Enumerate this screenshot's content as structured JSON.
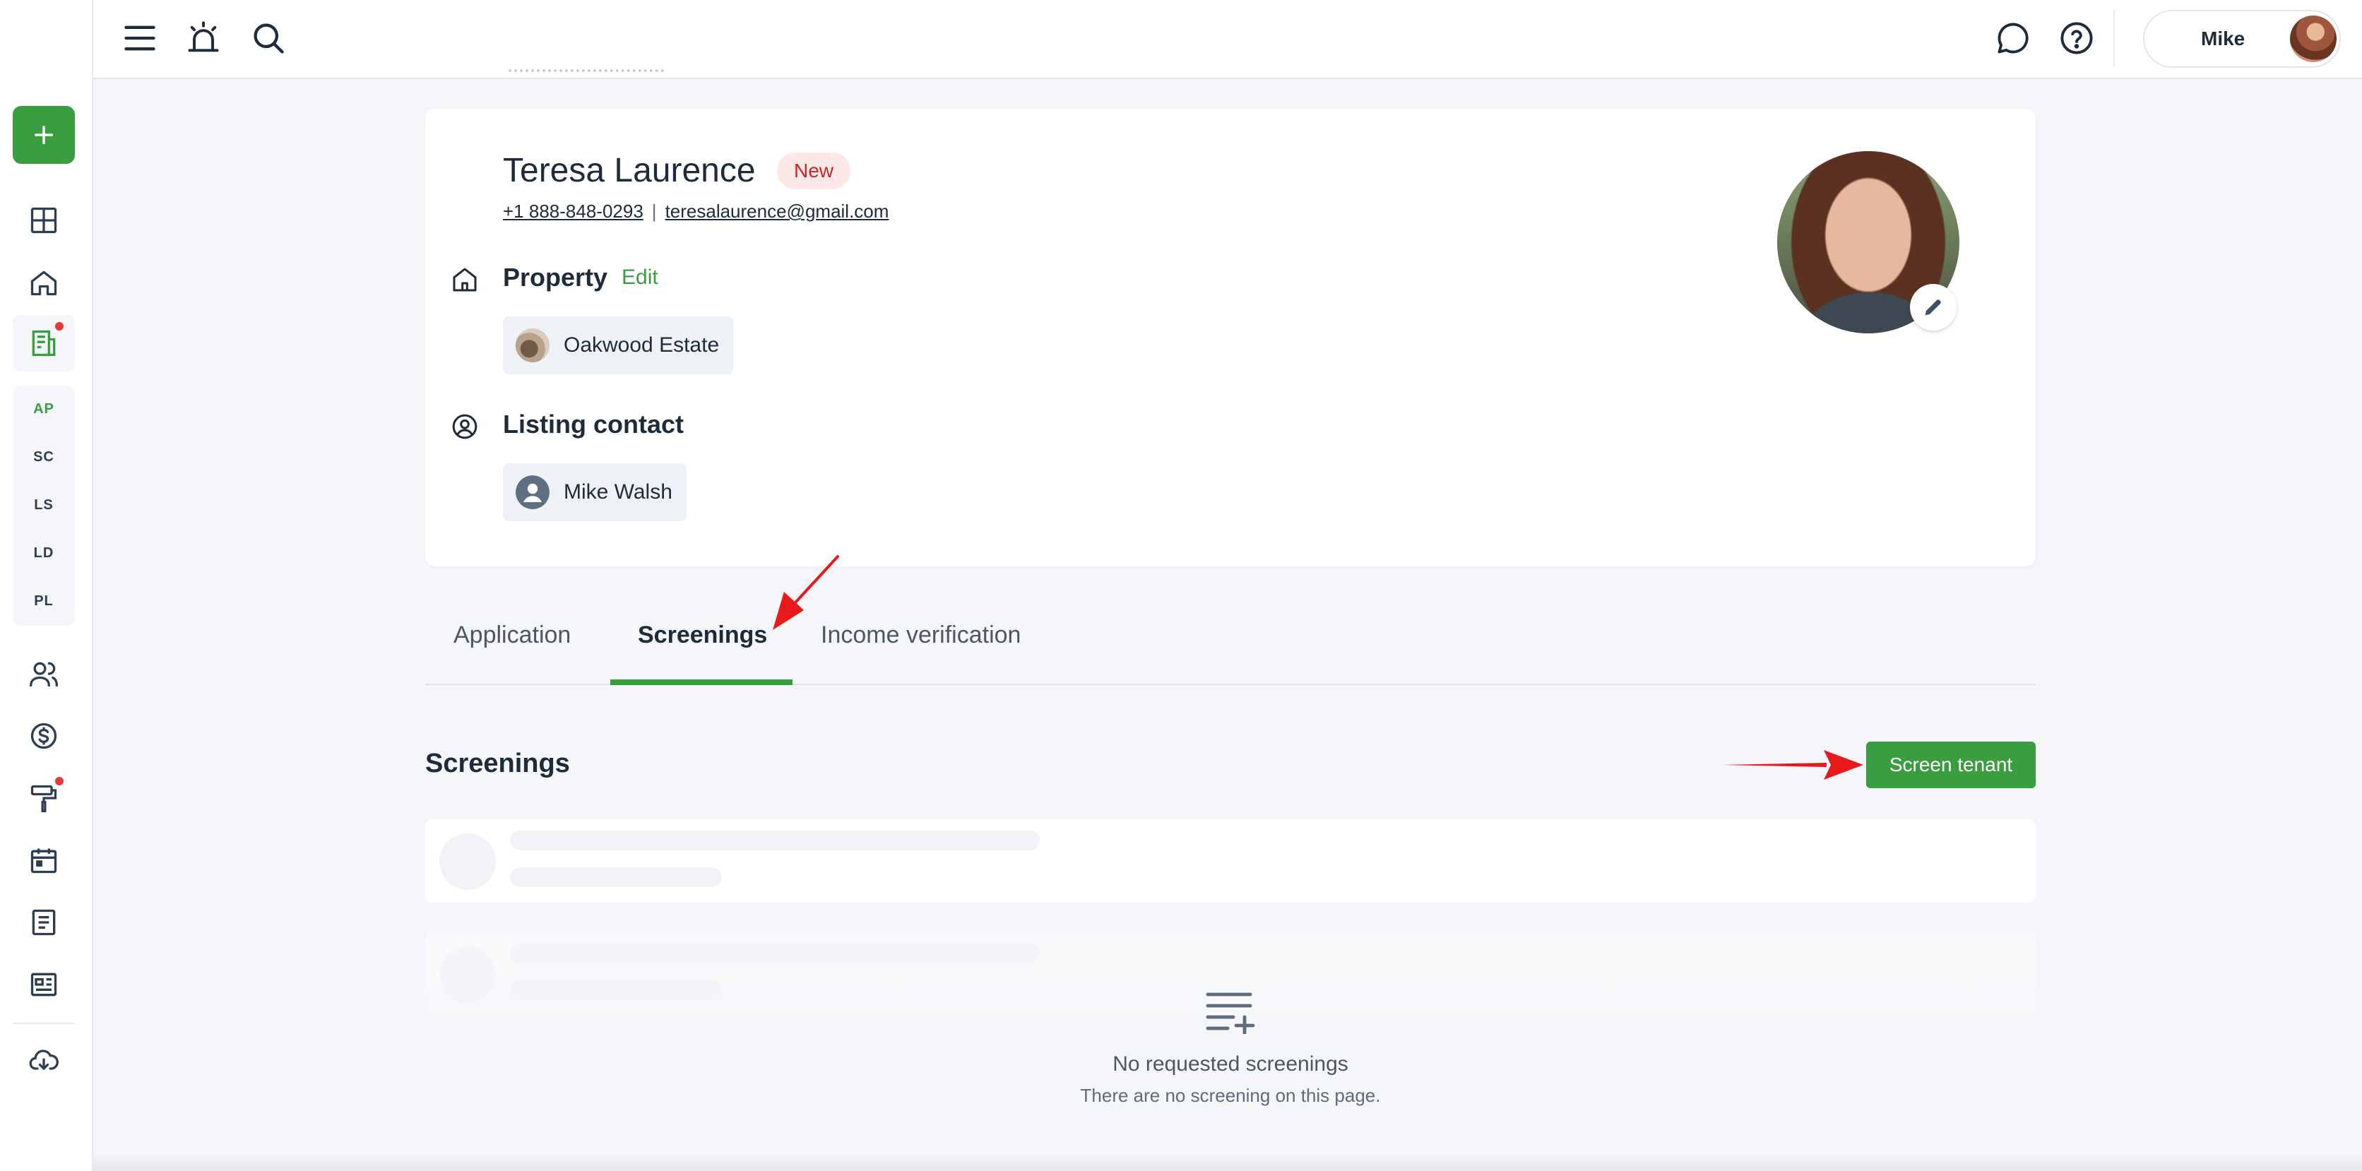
{
  "colors": {
    "accent": "#3a9d3f",
    "badge_bg": "#fde8e8",
    "badge_text": "#c62828",
    "annotation": "#e8191b"
  },
  "sidebar": {
    "add_icon": "plus-icon",
    "items": [
      {
        "icon": "dashboard-icon"
      },
      {
        "icon": "home-icon"
      },
      {
        "icon": "listings-icon",
        "notification": true
      },
      {
        "label": "AP"
      },
      {
        "label": "SC"
      },
      {
        "label": "LS"
      },
      {
        "label": "LD"
      },
      {
        "label": "PL"
      },
      {
        "icon": "users-icon"
      },
      {
        "icon": "dollar-icon"
      },
      {
        "icon": "paint-roller-icon",
        "notification": true
      },
      {
        "icon": "calendar-icon"
      },
      {
        "icon": "document-icon"
      },
      {
        "icon": "news-icon"
      },
      {
        "icon": "cloud-download-icon"
      }
    ]
  },
  "topbar": {
    "icons": [
      "menu-icon",
      "alarm-icon",
      "search-icon",
      "chat-icon",
      "help-icon"
    ],
    "user_name": "Mike"
  },
  "profile": {
    "name": "Teresa Laurence",
    "badge": "New",
    "phone": "+1 888-848-0293",
    "separator": "|",
    "email": "teresalaurence@gmail.com",
    "property": {
      "title": "Property",
      "edit_label": "Edit",
      "value": "Oakwood Estate"
    },
    "listing_contact": {
      "title": "Listing contact",
      "value": "Mike Walsh"
    }
  },
  "tabs": [
    {
      "label": "Application",
      "active": false
    },
    {
      "label": "Screenings",
      "active": true
    },
    {
      "label": "Income verification",
      "active": false
    }
  ],
  "screenings": {
    "title": "Screenings",
    "button_label": "Screen tenant",
    "empty_title": "No requested screenings",
    "empty_subtitle": "There are no screening on this page."
  }
}
